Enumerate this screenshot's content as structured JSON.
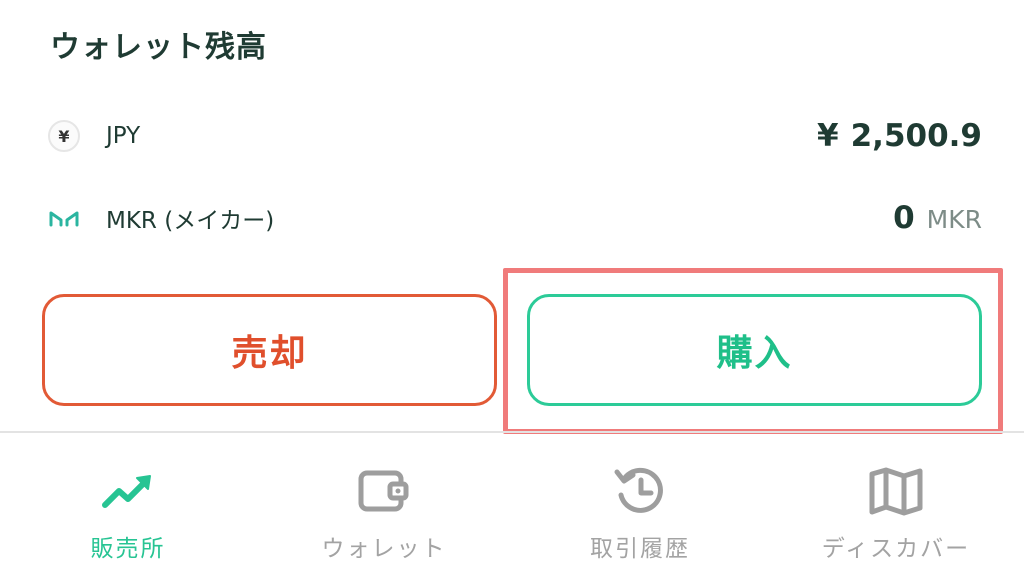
{
  "wallet": {
    "title": "ウォレット残高",
    "balances": [
      {
        "icon": "yen-icon",
        "icon_text": "¥",
        "name": "JPY",
        "prefix": "¥",
        "value": "2,500.9",
        "unit": ""
      },
      {
        "icon": "maker-logo-icon",
        "name": "MKR (メイカー)",
        "value": "0",
        "unit": "MKR"
      }
    ]
  },
  "actions": {
    "sell_label": "売却",
    "buy_label": "購入",
    "sell_color": "#e04f2c",
    "buy_color": "#1fbf89",
    "highlight_color": "#f07b7b"
  },
  "tabs": [
    {
      "label": "販売所",
      "icon": "trend-up-icon",
      "active": true
    },
    {
      "label": "ウォレット",
      "icon": "wallet-icon",
      "active": false
    },
    {
      "label": "取引履歴",
      "icon": "history-icon",
      "active": false
    },
    {
      "label": "ディスカバー",
      "icon": "map-icon",
      "active": false
    }
  ],
  "colors": {
    "active_tab": "#27c493",
    "inactive_tab": "#a3a3a3",
    "text_primary": "#1f3b33"
  }
}
